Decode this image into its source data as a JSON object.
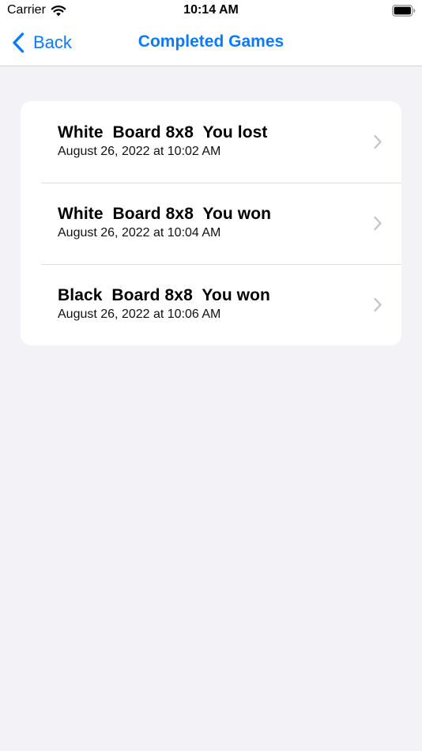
{
  "status_bar": {
    "carrier": "Carrier",
    "time": "10:14 AM"
  },
  "nav": {
    "back_label": "Back",
    "title": "Completed Games"
  },
  "games": [
    {
      "title": "White  Board 8x8  You lost",
      "date": "August 26, 2022 at 10:02 AM"
    },
    {
      "title": "White  Board 8x8  You won",
      "date": "August 26, 2022 at 10:04 AM"
    },
    {
      "title": "Black  Board 8x8  You won",
      "date": "August 26, 2022 at 10:06 AM"
    }
  ],
  "colors": {
    "accent": "#0a7aff",
    "background": "#f2f2f7",
    "card": "#ffffff",
    "chevron": "#c4c4c7"
  },
  "icons": {
    "wifi": "wifi-icon",
    "battery": "battery-icon",
    "back": "chevron-left-icon",
    "disclosure": "chevron-right-icon"
  }
}
